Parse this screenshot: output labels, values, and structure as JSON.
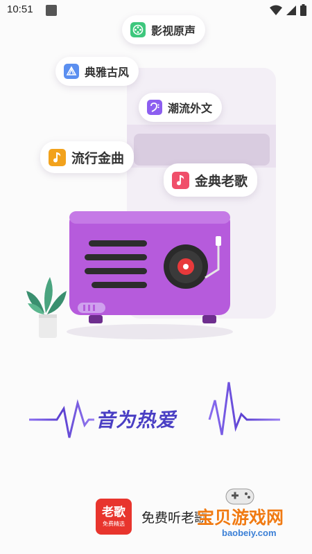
{
  "status_bar": {
    "time": "10:51"
  },
  "chips": [
    {
      "label": "影视原声",
      "icon": "film-reel-icon",
      "color": "#3ec77d"
    },
    {
      "label": "典雅古风",
      "icon": "fan-icon",
      "color": "#5b8ff0"
    },
    {
      "label": "潮流外文",
      "icon": "bass-clef-icon",
      "color": "#8c5ef0"
    },
    {
      "label": "流行金曲",
      "icon": "music-note-icon",
      "color": "#f2a21c"
    },
    {
      "label": "金典老歌",
      "icon": "music-note-icon",
      "color": "#f04f6a"
    }
  ],
  "tagline": "音为热爱",
  "brand": {
    "logo_text": "老歌",
    "logo_subtext": "免费精选",
    "slogan": "免费听老歌",
    "accent": "#e8352d"
  },
  "watermark": {
    "text": "宝贝游戏网",
    "url": "baobeiy.com"
  },
  "colors": {
    "radio": "#b65bdc",
    "tagline": "#4a3fc4",
    "wave": "#6b4fd8"
  }
}
